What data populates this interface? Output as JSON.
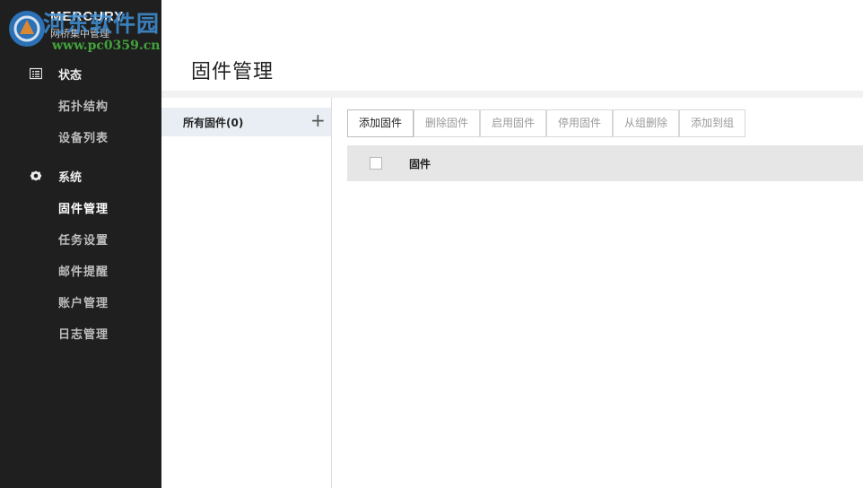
{
  "brand": {
    "name": "MERCURY",
    "subtitle": "网桥集中管理"
  },
  "watermark": {
    "text": "河东软件园",
    "url": "www.pc0359.cn"
  },
  "sidebar": {
    "groups": [
      {
        "label": "状态",
        "icon": "status-list-icon",
        "items": [
          {
            "label": "拓扑结构",
            "active": false
          },
          {
            "label": "设备列表",
            "active": false
          }
        ]
      },
      {
        "label": "系统",
        "icon": "gear-icon",
        "items": [
          {
            "label": "固件管理",
            "active": true
          },
          {
            "label": "任务设置",
            "active": false
          },
          {
            "label": "邮件提醒",
            "active": false
          },
          {
            "label": "账户管理",
            "active": false
          },
          {
            "label": "日志管理",
            "active": false
          }
        ]
      }
    ]
  },
  "page": {
    "title": "固件管理"
  },
  "group_panel": {
    "label": "所有固件",
    "count": "(0)",
    "add_icon": "plus-icon"
  },
  "toolbar": {
    "add": "添加固件",
    "delete": "删除固件",
    "enable": "启用固件",
    "disable": "停用固件",
    "remove_from_group": "从组删除",
    "add_to_group": "添加到组"
  },
  "table": {
    "columns": [
      "固件"
    ]
  },
  "colors": {
    "sidebar_bg": "#1f1f1f",
    "selected_group_bg": "#e8eef4",
    "table_header_bg": "#e6e6e6"
  }
}
